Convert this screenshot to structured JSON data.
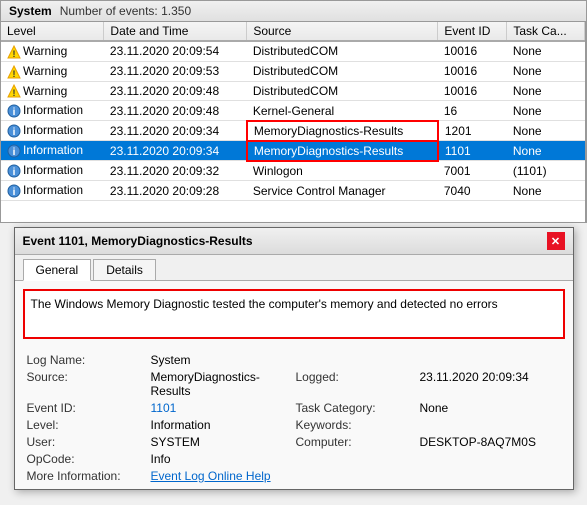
{
  "app": {
    "title": "System",
    "event_count_label": "Number of events: 1.350"
  },
  "table": {
    "columns": [
      "Level",
      "Date and Time",
      "Source",
      "Event ID",
      "Task Ca..."
    ],
    "rows": [
      {
        "level": "Warning",
        "level_type": "warning",
        "datetime": "23.11.2020 20:09:54",
        "source": "DistributedCOM",
        "event_id": "10016",
        "task": "None",
        "selected": false,
        "highlight_source": false
      },
      {
        "level": "Warning",
        "level_type": "warning",
        "datetime": "23.11.2020 20:09:53",
        "source": "DistributedCOM",
        "event_id": "10016",
        "task": "None",
        "selected": false,
        "highlight_source": false
      },
      {
        "level": "Warning",
        "level_type": "warning",
        "datetime": "23.11.2020 20:09:48",
        "source": "DistributedCOM",
        "event_id": "10016",
        "task": "None",
        "selected": false,
        "highlight_source": false
      },
      {
        "level": "Information",
        "level_type": "info",
        "datetime": "23.11.2020 20:09:48",
        "source": "Kernel-General",
        "event_id": "16",
        "task": "None",
        "selected": false,
        "highlight_source": false
      },
      {
        "level": "Information",
        "level_type": "info",
        "datetime": "23.11.2020 20:09:34",
        "source": "MemoryDiagnostics-Results",
        "event_id": "1201",
        "task": "None",
        "selected": false,
        "highlight_source": true
      },
      {
        "level": "Information",
        "level_type": "info",
        "datetime": "23.11.2020 20:09:34",
        "source": "MemoryDiagnostics-Results",
        "event_id": "1101",
        "task": "None",
        "selected": true,
        "highlight_source": true
      },
      {
        "level": "Information",
        "level_type": "info",
        "datetime": "23.11.2020 20:09:32",
        "source": "Winlogon",
        "event_id": "7001",
        "task": "(1101)",
        "selected": false,
        "highlight_source": false
      },
      {
        "level": "Information",
        "level_type": "info",
        "datetime": "23.11.2020 20:09:28",
        "source": "Service Control Manager",
        "event_id": "7040",
        "task": "None",
        "selected": false,
        "highlight_source": false
      }
    ]
  },
  "dialog": {
    "title": "Event 1101, MemoryDiagnostics-Results",
    "tabs": [
      "General",
      "Details"
    ],
    "active_tab": "General",
    "message": "The Windows Memory Diagnostic tested the computer's memory and detected no errors",
    "properties": {
      "log_name_label": "Log Name:",
      "log_name_value": "System",
      "source_label": "Source:",
      "source_value": "MemoryDiagnostics-Results",
      "logged_label": "Logged:",
      "logged_value": "23.11.2020 20:09:34",
      "event_id_label": "Event ID:",
      "event_id_value": "1101",
      "task_category_label": "Task Category:",
      "task_category_value": "None",
      "level_label": "Level:",
      "level_value": "Information",
      "keywords_label": "Keywords:",
      "keywords_value": "",
      "user_label": "User:",
      "user_value": "SYSTEM",
      "computer_label": "Computer:",
      "computer_value": "DESKTOP-8AQ7M0S",
      "opcode_label": "OpCode:",
      "opcode_value": "Info",
      "more_info_label": "More Information:",
      "more_info_link": "Event Log Online Help"
    }
  }
}
